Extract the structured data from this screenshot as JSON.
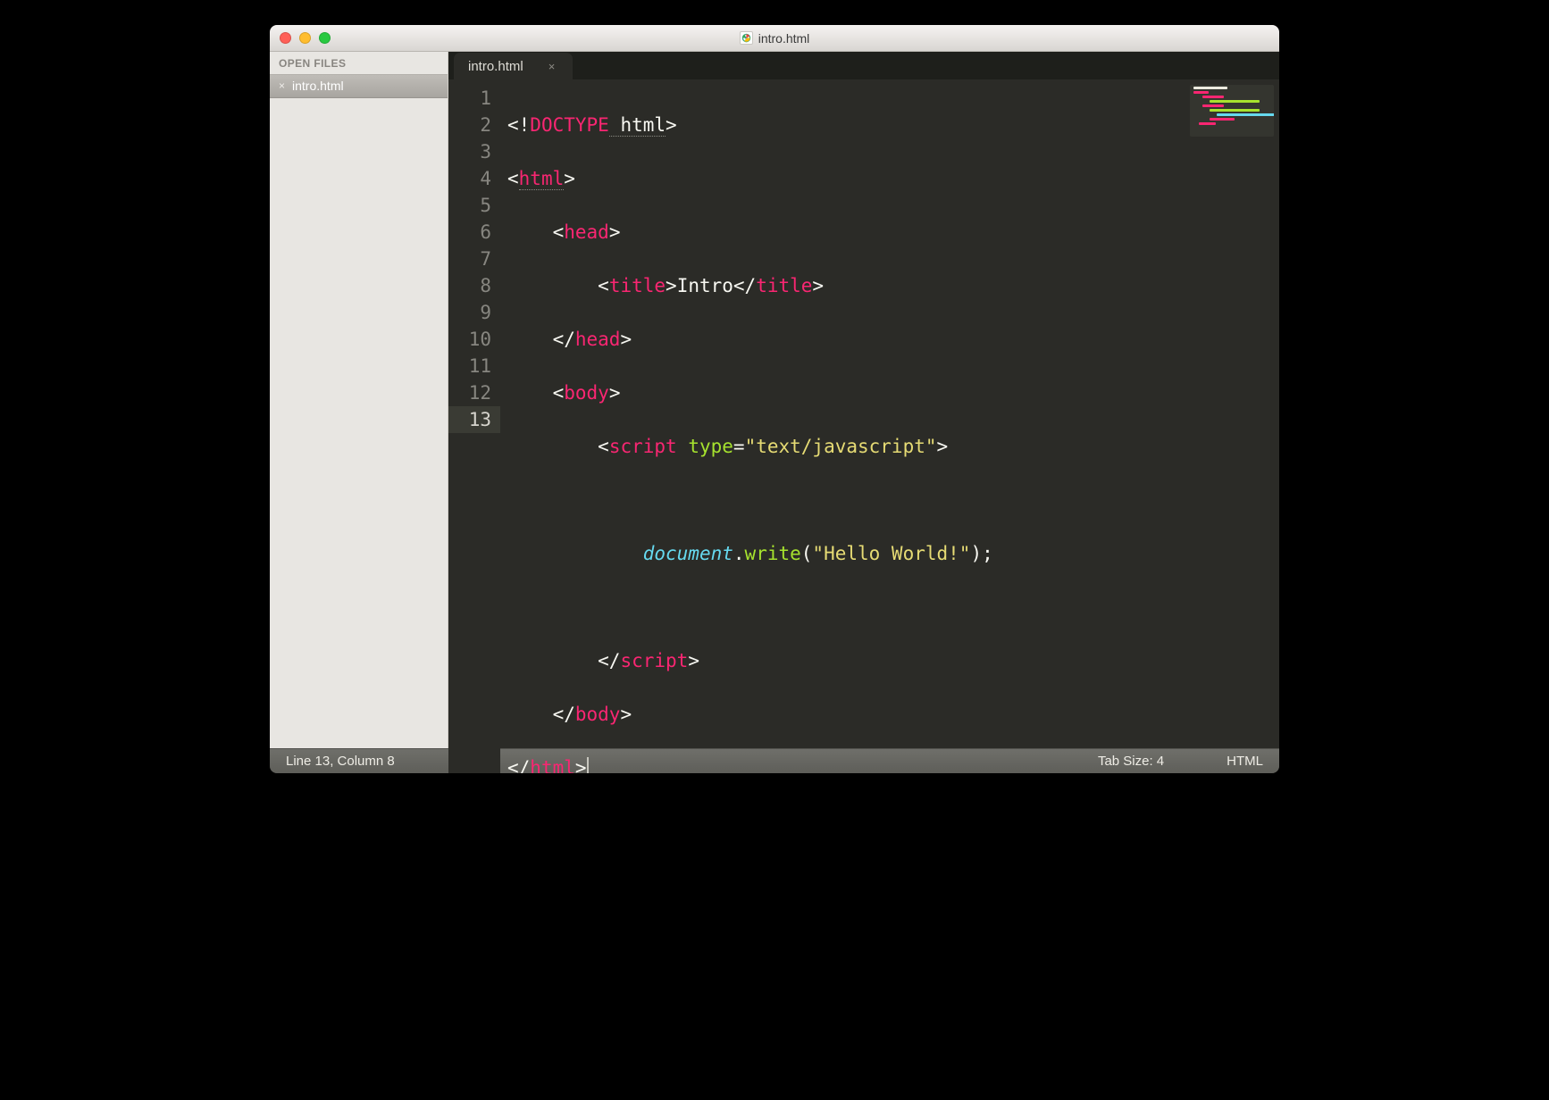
{
  "window": {
    "title": "intro.html"
  },
  "sidebar": {
    "header": "OPEN FILES",
    "items": [
      {
        "label": "intro.html"
      }
    ]
  },
  "tabs": [
    {
      "label": "intro.html"
    }
  ],
  "code": {
    "line_numbers": [
      "1",
      "2",
      "3",
      "4",
      "5",
      "6",
      "7",
      "8",
      "9",
      "10",
      "11",
      "12",
      "13"
    ],
    "current_line": 13,
    "l1": {
      "a": "<!",
      "b": "DOCTYPE",
      "c": " html",
      "d": ">"
    },
    "l2": {
      "a": "<",
      "b": "html",
      "c": ">"
    },
    "l3": {
      "a": "<",
      "b": "head",
      "c": ">"
    },
    "l4": {
      "a": "<",
      "b": "title",
      "c": ">",
      "d": "Intro",
      "e": "</",
      "f": "title",
      "g": ">"
    },
    "l5": {
      "a": "</",
      "b": "head",
      "c": ">"
    },
    "l6": {
      "a": "<",
      "b": "body",
      "c": ">"
    },
    "l7": {
      "a": "<",
      "b": "script",
      "c": " ",
      "d": "type",
      "e": "=",
      "f": "\"text/javascript\"",
      "g": ">"
    },
    "l9": {
      "a": "document",
      "b": ".",
      "c": "write",
      "d": "(",
      "e": "\"Hello World!\"",
      "f": ");"
    },
    "l11": {
      "a": "</",
      "b": "script",
      "c": ">"
    },
    "l12": {
      "a": "</",
      "b": "body",
      "c": ">"
    },
    "l13": {
      "a": "</",
      "b": "html",
      "c": ">"
    }
  },
  "status": {
    "position": "Line 13, Column 8",
    "tab_size": "Tab Size: 4",
    "syntax": "HTML"
  }
}
